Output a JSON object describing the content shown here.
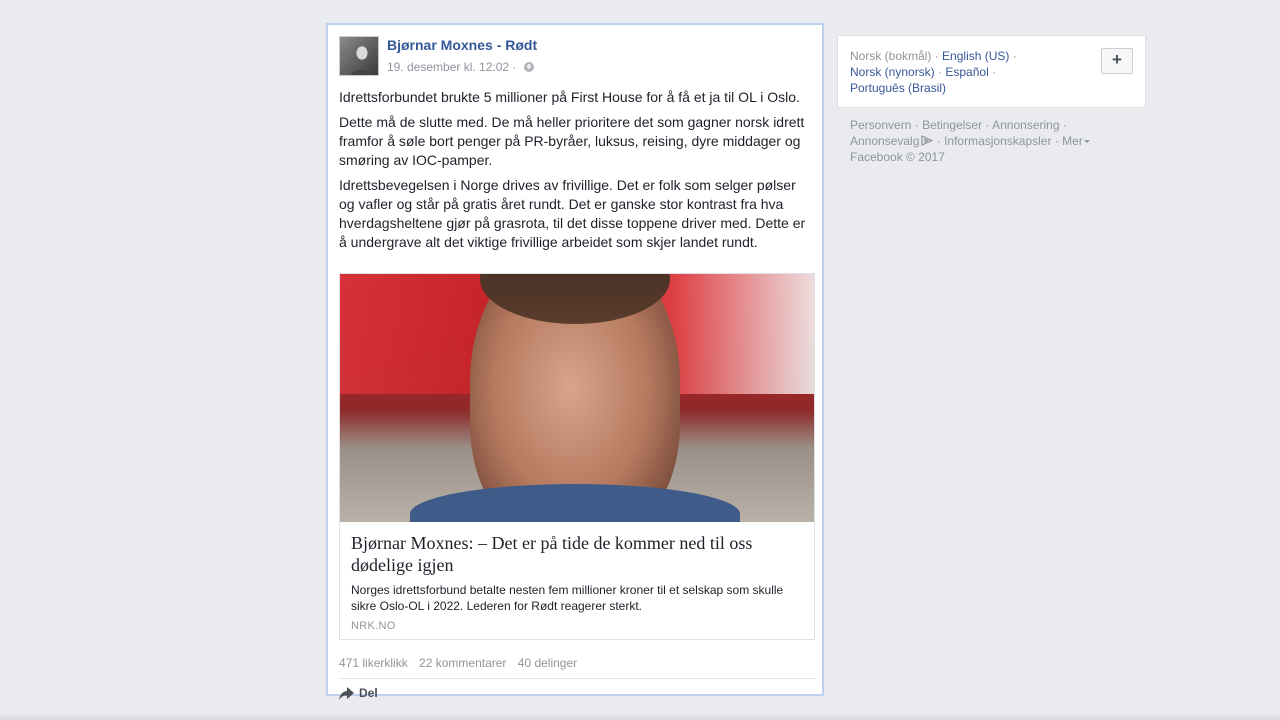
{
  "post": {
    "author": "Bjørnar Moxnes - Rødt",
    "timestamp": "19. desember kl. 12:02",
    "privacy_sep": "·",
    "paragraphs": [
      "Idrettsforbundet brukte 5 millioner på First House for å få et ja til OL i Oslo.",
      "Dette må de slutte med. De må heller prioritere det som gagner norsk idrett framfor å søle bort penger på PR-byråer, luksus, reising, dyre middager og smøring av IOC-pamper.",
      "Idrettsbevegelsen i Norge drives av frivillige. Det er folk som selger pølser og vafler og står på gratis året rundt. Det er ganske stor kontrast fra hva hverdagsheltene gjør på grasrota, til det disse toppene driver med. Dette er å undergrave alt det viktige frivillige arbeidet som skjer landet rundt."
    ],
    "link": {
      "title": "Bjørnar Moxnes: – Det er på tide de kommer ned til oss dødelige igjen",
      "description": "Norges idrettsforbund betalte nesten fem millioner kroner til et selskap som skulle sikre Oslo-OL i 2022. Lederen for Rødt reagerer sterkt.",
      "source": "NRK.NO"
    },
    "stats": {
      "likes": "471 likerklikk",
      "comments": "22 kommentarer",
      "shares": "40 delinger"
    },
    "share_label": "Del"
  },
  "languages": {
    "current": "Norsk (bokmål)",
    "items": [
      "English (US)",
      "Norsk (nynorsk)",
      "Español",
      "Português (Brasil)"
    ],
    "add_label": "+"
  },
  "footer": {
    "links": [
      "Personvern",
      "Betingelser",
      "Annonsering",
      "Annonsevalg",
      "Informasjonskapsler",
      "Mer"
    ],
    "copyright": "Facebook © 2017"
  },
  "icons": {
    "privacy": "globe-icon",
    "share": "share-arrow-icon",
    "adchoices": "adchoices-icon",
    "more": "caret-down-icon"
  },
  "colors": {
    "background": "#e9ebee",
    "link_blue": "#365899",
    "muted": "#90949c",
    "highlight_border": "#bdd0ee"
  }
}
